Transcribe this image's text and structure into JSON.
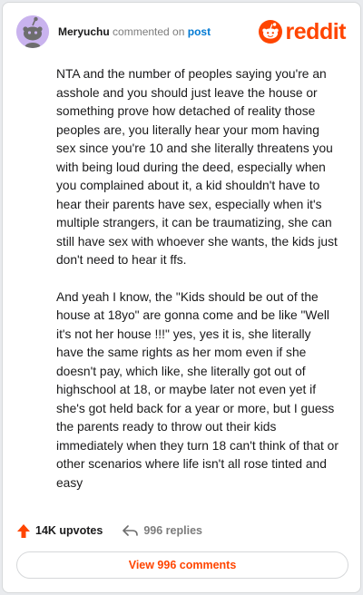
{
  "comment": {
    "username": "Meryuchu",
    "commented_on_text": "commented on",
    "target_link": "post",
    "avatar_icon": "snoo-avatar-icon",
    "paragraphs": [
      "NTA and the number of peoples saying you're an asshole and you should just leave the house or something prove how detached of reality those peoples are, you literally hear your mom having sex since you're 10 and she literally threatens you with being loud during the deed, especially when you complained about it, a kid shouldn't have to hear their parents have sex, especially when it's multiple strangers, it can be traumatizing, she can still have sex with whoever she wants, the kids just don't need to hear it ffs.",
      "And yeah I know, the \"Kids should be out of the house at 18yo\" are gonna come and be like \"Well it's not her house !!!\" yes, yes it is, she literally have the same rights as her mom even if she doesn't pay, which like, she literally got out of highschool at 18, or maybe later not even yet if she's got held back for a year or more, but I guess the parents ready to throw out their kids immediately when they turn 18 can't think of that or other scenarios where life isn't all rose tinted and easy"
    ]
  },
  "brand": {
    "logo_text": "reddit",
    "logo_icon": "reddit-alien-icon",
    "color": "#ff4500"
  },
  "actions": {
    "upvotes": "14K upvotes",
    "upvote_icon": "upvote-arrow-icon",
    "replies": "996 replies",
    "reply_icon": "reply-arrow-icon"
  },
  "footer": {
    "view_comments_label": "View 996 comments"
  },
  "colors": {
    "accent": "#ff4500",
    "link": "#0079d3",
    "avatar_bg": "#c9b3ee",
    "muted": "#7c7c7c"
  }
}
